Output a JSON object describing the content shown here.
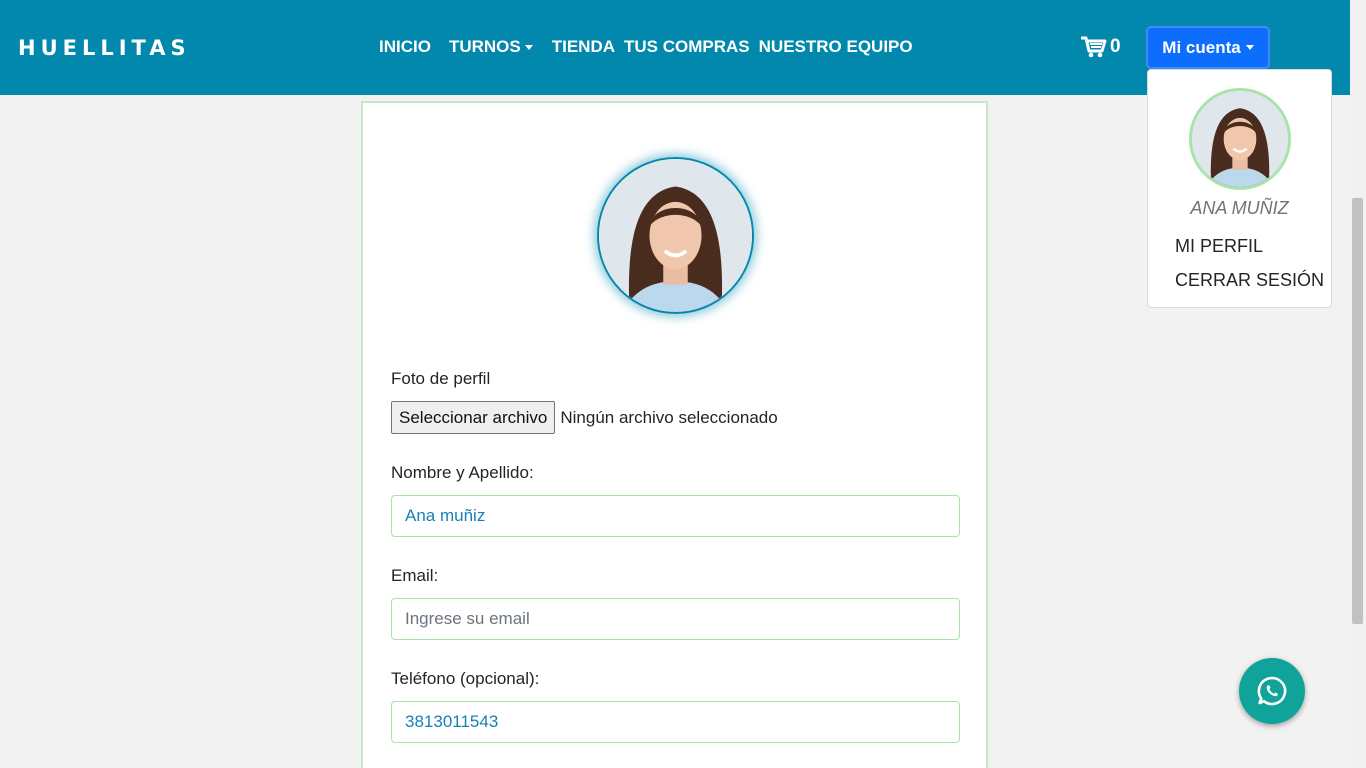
{
  "navbar": {
    "brand": "HUELLITAS",
    "links": [
      "INICIO",
      "TURNOS",
      "TIENDA",
      "TUS COMPRAS",
      "NUESTRO EQUIPO"
    ],
    "cart_count": "0",
    "account_label": "Mi cuenta",
    "bg_color": "#0388ad",
    "account_color": "#0d6efd"
  },
  "dropdown": {
    "user_name": "ANA MUÑIZ",
    "items": [
      "MI PERFIL",
      "CERRAR SESIÓN"
    ]
  },
  "form": {
    "photo_label": "Foto de perfil",
    "file_button": "Seleccionar archivo",
    "file_status": "Ningún archivo seleccionado",
    "name_label": "Nombre y Apellido:",
    "name_value": "Ana muñiz",
    "email_label": "Email:",
    "email_placeholder": "Ingrese su email",
    "phone_label": "Teléfono (opcional):",
    "phone_value": "3813011543"
  },
  "icons": [
    "cart-icon",
    "whatsapp-icon",
    "caret-down-icon"
  ]
}
